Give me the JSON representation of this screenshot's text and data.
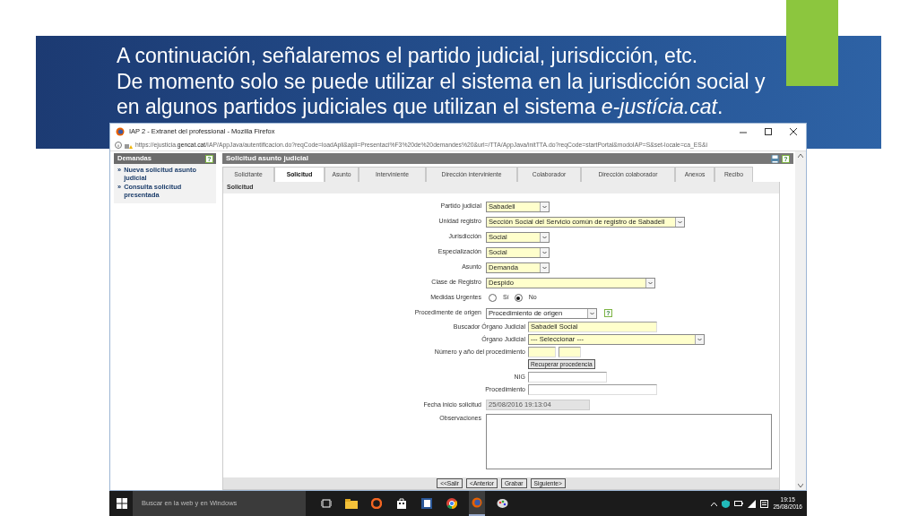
{
  "slide": {
    "title": "A continuación, señalaremos el partido judicial, jurisdicción, etc.",
    "text": "De momento solo se puede utilizar el sistema en la jurisdicción social y en algunos partidos judiciales que utilizan el sistema *e-justícia.cat*."
  },
  "window": {
    "title": "IAP 2 - Extranet del professional - Mozilla Firefox",
    "url": "https://ejusticia.**gencat.cat**/IAP/AppJava/autentificacion.do?reqCode=loadApli&apli=Presentaci%F3%20de%20demandes%20&url=/TTA/AppJava/initTTA.do?reqCode=startPortal&modoIAP=S&set-locale=ca_ES&i"
  },
  "sidebar": {
    "title": "Demandas",
    "help": "?",
    "items": [
      {
        "bullet": "»",
        "label": "Nueva solicitud asunto judicial"
      },
      {
        "bullet": "»",
        "label": "Consulta solicitud presentada"
      }
    ]
  },
  "page": {
    "title": "Solicitud asunto judicial",
    "help": "?"
  },
  "tabs": [
    {
      "label": "Solicitante",
      "selected": false
    },
    {
      "label": "Solicitud",
      "selected": true
    },
    {
      "label": "Asunto",
      "selected": false
    },
    {
      "label": "Interviniente",
      "selected": false
    },
    {
      "label": "Dirección interviniente",
      "selected": false
    },
    {
      "label": "Colaborador",
      "selected": false
    },
    {
      "label": "Dirección colaborador",
      "selected": false
    },
    {
      "label": "Anexos",
      "selected": false
    },
    {
      "label": "Recibo",
      "selected": false
    }
  ],
  "section": "Solicitud",
  "fields": [
    {
      "kind": "select",
      "label": "Partido judicial",
      "value": "Sabadell",
      "required": true
    },
    {
      "kind": "select",
      "label": "Unidad registro",
      "value": "Sección Social del Servicio común de registro de Sabadell",
      "required": true
    },
    {
      "kind": "select",
      "label": "Jurisdicción",
      "value": "Social",
      "required": true
    },
    {
      "kind": "select",
      "label": "Especialización",
      "value": "Social",
      "required": true
    },
    {
      "kind": "select",
      "label": "Asunto",
      "value": "Demanda",
      "required": true
    },
    {
      "kind": "select",
      "label": "Clase de Registro",
      "value": "Despido",
      "required": true
    },
    {
      "kind": "radio",
      "label": "Medidas Urgentes",
      "options": [
        {
          "label": "Sí",
          "selected": false
        },
        {
          "label": "No",
          "selected": true
        }
      ]
    },
    {
      "kind": "select",
      "label": "Procedimente de origen",
      "value": "Procedimiento de origen",
      "required": false,
      "help": "?"
    }
  ],
  "search_fields": [
    {
      "kind": "text",
      "label": "Buscador Órgano Judicial",
      "value": "Sabadell Social",
      "required": true
    },
    {
      "kind": "select",
      "label": "Órgano Judicial",
      "value": "--- Seleccionar ---",
      "required": true
    },
    {
      "kind": "pair",
      "label": "Número y año del procedimiento",
      "required": true
    },
    {
      "kind": "button",
      "label": "Recuperar procedencia"
    },
    {
      "kind": "text",
      "label": "NIG",
      "required": false
    },
    {
      "kind": "text",
      "label": "Procedimiento",
      "required": false
    }
  ],
  "details": [
    {
      "kind": "readonly",
      "label": "Fecha inicio solicitud",
      "value": "25/08/2016 19:13:04"
    },
    {
      "kind": "textarea",
      "label": "Observaciones"
    }
  ],
  "buttons": [
    "<<Salir",
    "<Anterior",
    "Grabar",
    "Siguiente>"
  ],
  "taskbar": {
    "search_placeholder": "Buscar en la web y en Windows",
    "time": "19:15",
    "date": "25/08/2016"
  }
}
